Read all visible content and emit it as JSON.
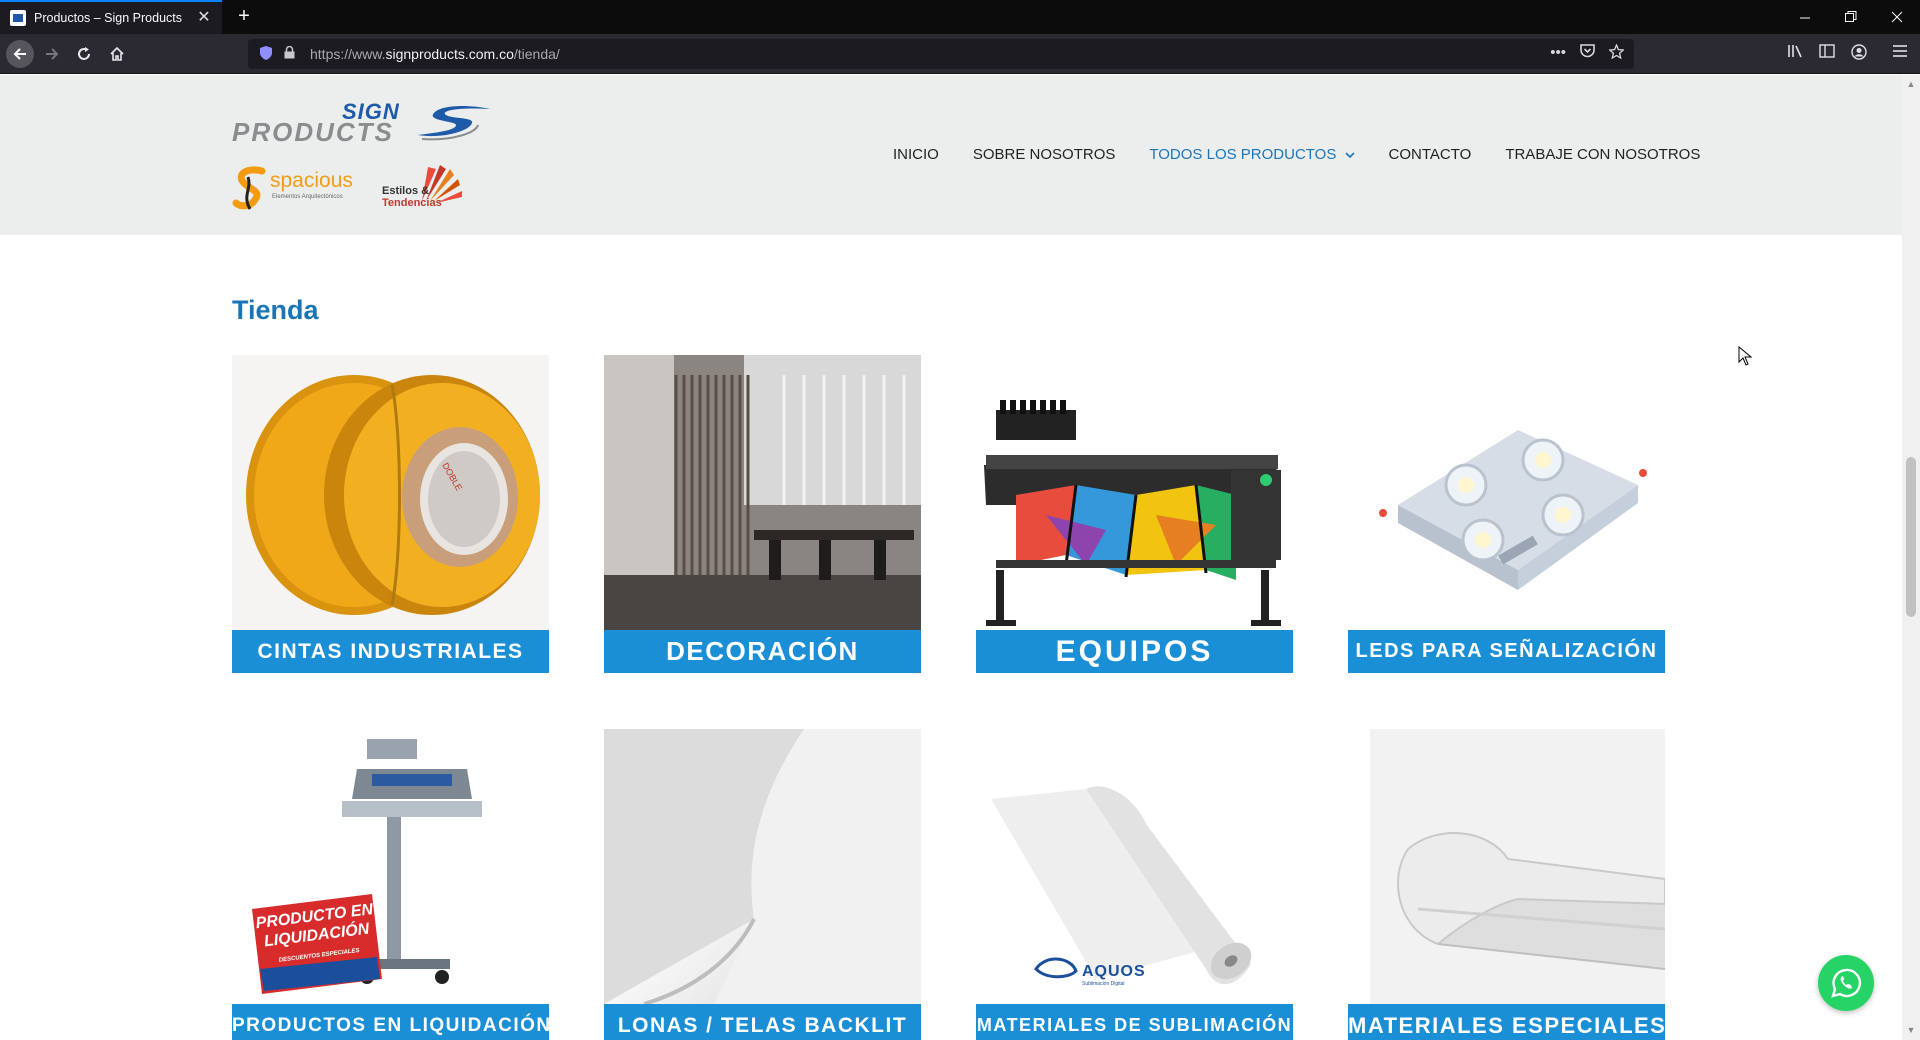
{
  "browser": {
    "tab_title": "Productos – Sign Products",
    "url_prefix": "https://www.",
    "url_host": "signproducts.com.co",
    "url_path": "/tienda/",
    "tab_close": "✕",
    "new_tab": "+"
  },
  "site": {
    "logo_sign": "SIGN",
    "logo_products": "PRODUCTS",
    "logo_spacious": "spacious",
    "logo_spacious_sub": "Elementos Arquitectónicos",
    "logo_estilos": "Estilos &",
    "logo_tendencias": "Tendencias",
    "nav": [
      {
        "label": "INICIO",
        "active": false
      },
      {
        "label": "SOBRE NOSOTROS",
        "active": false
      },
      {
        "label": "TODOS LOS PRODUCTOS",
        "active": true
      },
      {
        "label": "CONTACTO",
        "active": false
      },
      {
        "label": "TRABAJE CON NOSOTROS",
        "active": false
      }
    ]
  },
  "page": {
    "title": "Tienda",
    "categories": [
      {
        "label": "CINTAS INDUSTRIALES",
        "image": "tape-rolls"
      },
      {
        "label": "DECORACIÓN",
        "image": "office-glass-partition"
      },
      {
        "label": "EQUIPOS",
        "image": "wide-format-printer"
      },
      {
        "label": "LEDS PARA SEÑALIZACIÓN",
        "image": "led-module"
      },
      {
        "label": "PRODUCTOS EN LIQUIDACIÓN",
        "image": "heat-press",
        "badge_line1": "PRODUCTO EN",
        "badge_line2": "LIQUIDACIÓN",
        "badge_sub": "DESCUENTOS ESPECIALES"
      },
      {
        "label": "LONAS / TELAS BACKLIT",
        "image": "backlit-fabric"
      },
      {
        "label": "MATERIALES DE SUBLIMACIÓN",
        "image": "paper-roll",
        "brand": "AQUOS",
        "brand_sub": "Sublimación Digital"
      },
      {
        "label": "MATERIALES ESPECIALES",
        "image": "clear-film"
      }
    ]
  },
  "colors": {
    "accent": "#1b8fd6",
    "title": "#1a75b8",
    "whatsapp": "#25d366"
  }
}
